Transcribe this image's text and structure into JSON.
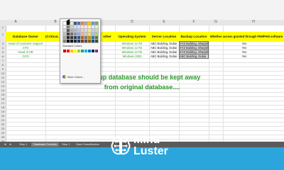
{
  "spreadsheet": {
    "columns": [
      "A",
      "B",
      "C",
      "D",
      "E",
      "F",
      "G",
      "H"
    ],
    "row_numbers": [
      "1",
      "2",
      "3",
      "4",
      "5",
      "6",
      "7",
      "8",
      "9",
      "10",
      "11",
      "12",
      "13",
      "14",
      "15",
      "16",
      "17",
      "18",
      "19",
      "20",
      "21",
      "22",
      "23",
      "24",
      "25",
      "26",
      "27",
      "28",
      "29"
    ],
    "headers": {
      "database_owner": "Database Owner",
      "criticality": "(Critical... criticality)",
      "other": "other",
      "operating_system": "Operating System",
      "server_location": "Server Location",
      "backup_location": "Backup Location",
      "pim_pam": "Whether access granted through PIM/PAM software"
    },
    "rows": [
      {
        "owner": "Head of Customer Support",
        "os": "Windows 12 R2",
        "server": "ABC Building, Dubai",
        "backup": "XYZ Building, Sharjah",
        "pim": "Yes"
      },
      {
        "owner": "CFO",
        "os": "Windows 12 R2",
        "server": "ABC Building, Dubai",
        "backup": "XYZ Building, Sharjah",
        "pim": "Yes"
      },
      {
        "owner": "Head of HR",
        "os": "Windows 12 R2",
        "server": "ABC Building, Dubai",
        "backup": "XYZ Building, Sharjah",
        "pim": "Yes"
      },
      {
        "owner": "COO",
        "os": "Windows 2003",
        "server": "ABC Building, Dubai",
        "backup": "ABC Building, Dubai",
        "pim": "Yes"
      }
    ]
  },
  "color_menu": {
    "standard_colors_label": "Standard Colors",
    "more_colors_label": "More Colors...",
    "theme_colors": [
      "#ffffff",
      "#000000",
      "#e7e6e6",
      "#44546a",
      "#4472c4",
      "#ed7d31",
      "#a5a5a5",
      "#ffc000",
      "#5b9bd5",
      "#70ad47",
      "#f2f2f2",
      "#7f7f7f",
      "#d0cece",
      "#d6dce4",
      "#d9e2f3",
      "#fbe5d5",
      "#ededed",
      "#fff2cc",
      "#deebf6",
      "#e2efd9",
      "#d8d8d8",
      "#595959",
      "#aeabab",
      "#adb9ca",
      "#b4c6e7",
      "#f7caac",
      "#dbdbdb",
      "#fee599",
      "#bdd7ee",
      "#c5e0b3",
      "#bfbfbf",
      "#3f3f3f",
      "#757070",
      "#8496b0",
      "#8eaadb",
      "#f4b083",
      "#c9c9c9",
      "#ffd965",
      "#9cc3e5",
      "#a8d08d",
      "#a5a5a5",
      "#262626",
      "#3a3838",
      "#323f4f",
      "#2f5496",
      "#c55a11",
      "#7b7b7b",
      "#bf9000",
      "#2e75b5",
      "#538135",
      "#7f7f7f",
      "#0c0c0c",
      "#171616",
      "#222a35",
      "#1f3864",
      "#833c0b",
      "#525252",
      "#7f6000",
      "#1e4e79",
      "#375623"
    ],
    "standard_colors": [
      "#c00000",
      "#ff0000",
      "#ffc000",
      "#ffff00",
      "#92d050",
      "#00b050",
      "#00b0f0",
      "#0070c0",
      "#002060",
      "#7030a0"
    ]
  },
  "caption": {
    "line1": "Backup database should be kept away",
    "line2": "from original database...."
  },
  "sheet_tabs": [
    {
      "label": "Step 1",
      "active": false
    },
    {
      "label": "Database Controls",
      "active": true
    },
    {
      "label": "Step 2",
      "active": false
    },
    {
      "label": "Data Classification",
      "active": false
    }
  ],
  "logo": {
    "line1": "Mind",
    "line2": "Luster"
  },
  "colors": {
    "banner": "#2aa6dd",
    "header_fill": "#ffff00",
    "caption_text": "#2e9a2e"
  }
}
